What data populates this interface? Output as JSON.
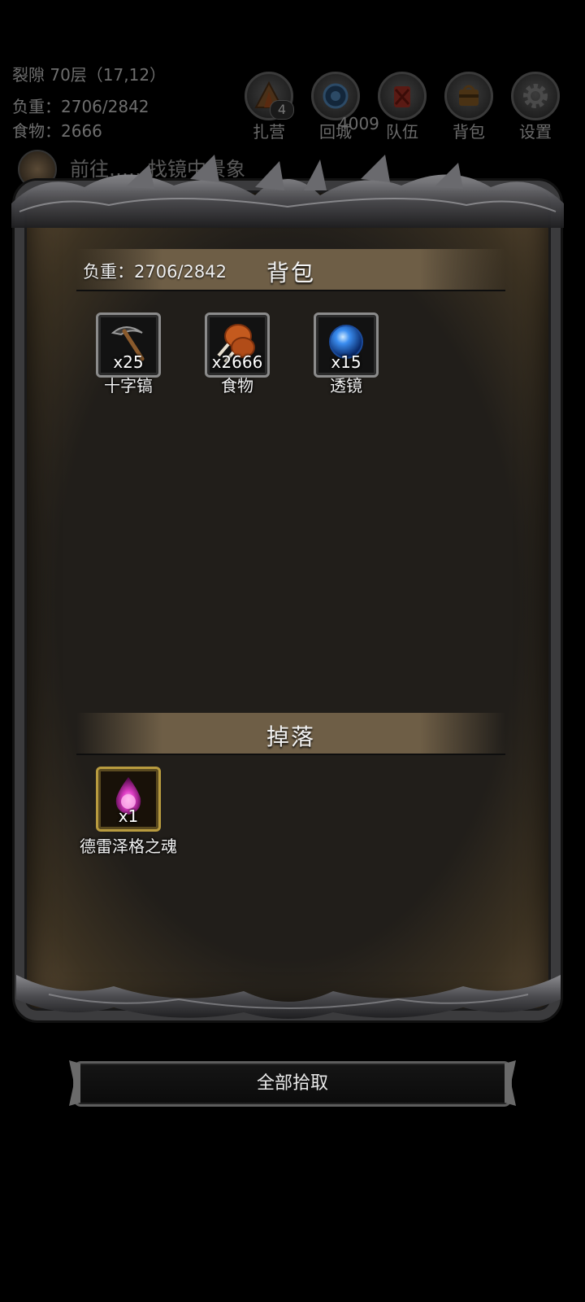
{
  "hud": {
    "location": "裂隙 70层（17,12）",
    "load": "负重：2706/2842",
    "food": "食物：2666",
    "buttons": [
      {
        "label": "扎营",
        "icon": "camp-icon",
        "badge": "4"
      },
      {
        "label": "回城",
        "icon": "portal-icon",
        "count": "4009"
      },
      {
        "label": "队伍",
        "icon": "team-icon"
      },
      {
        "label": "背包",
        "icon": "backpack-icon"
      },
      {
        "label": "设置",
        "icon": "gear-icon"
      }
    ],
    "quest": "前往……找镜中景象"
  },
  "backpack": {
    "title": "背包",
    "weight": "负重：2706/2842",
    "items": [
      {
        "name": "十字镐",
        "qty": "x25",
        "icon": "pickaxe-icon"
      },
      {
        "name": "食物",
        "qty": "x2666",
        "icon": "meat-icon"
      },
      {
        "name": "透镜",
        "qty": "x15",
        "icon": "lens-orb-icon"
      }
    ]
  },
  "drops": {
    "title": "掉落",
    "items": [
      {
        "name": "德雷泽格之魂",
        "qty": "x1",
        "icon": "soul-flame-icon"
      }
    ]
  },
  "actions": {
    "pick_all": "全部拾取"
  }
}
